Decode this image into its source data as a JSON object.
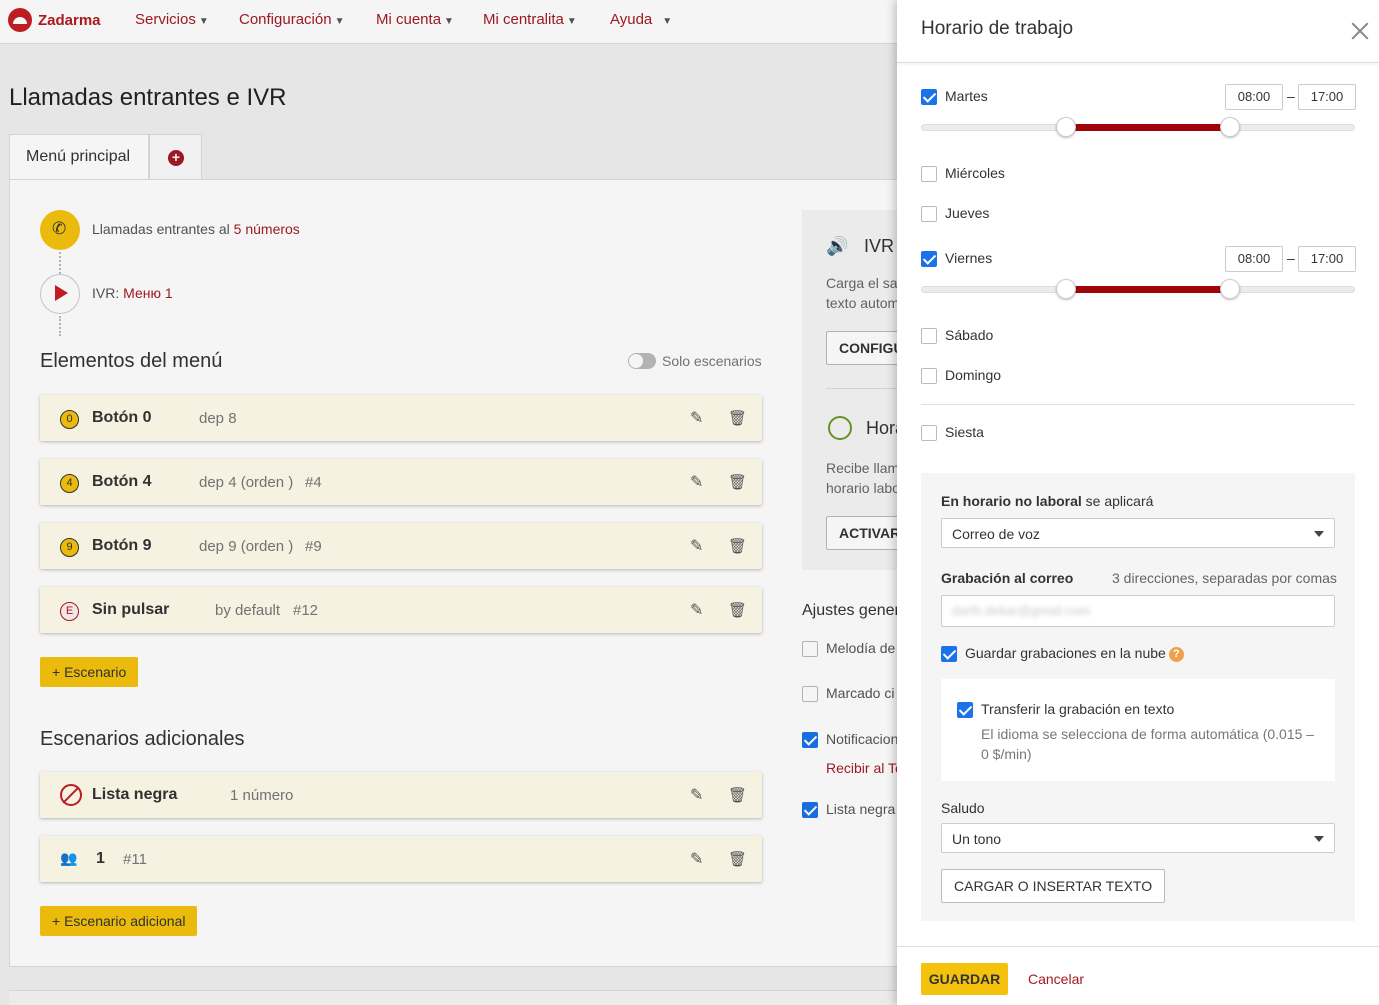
{
  "nav": {
    "logo": "Zadarma",
    "items": [
      {
        "label": "Servicios"
      },
      {
        "label": "Configuración"
      },
      {
        "label": "Mi cuenta"
      },
      {
        "label": "Mi centralita"
      },
      {
        "label": "Ayuda"
      }
    ]
  },
  "page": {
    "title": "Llamadas entrantes e IVR",
    "tabs": [
      {
        "label": "Menú principal"
      },
      {
        "label": "+"
      }
    ]
  },
  "flow": {
    "incoming_prefix": "Llamadas entrantes al",
    "incoming_link": "5 números",
    "ivr_prefix": "IVR:",
    "ivr_link": "Меню 1"
  },
  "menu": {
    "heading": "Elementos del menú",
    "toggle_label": "Solo escenarios",
    "rows": [
      {
        "badge": "0",
        "title": "Botón 0",
        "sub": "dep 8",
        "num": ""
      },
      {
        "badge": "4",
        "title": "Botón 4",
        "sub": "dep 4 (orden )",
        "num": "#4"
      },
      {
        "badge": "9",
        "title": "Botón 9",
        "sub": "dep 9 (orden )",
        "num": "#9"
      },
      {
        "badge": "E",
        "title": "Sin pulsar",
        "sub": "by default",
        "num": "#12"
      }
    ],
    "add_scenario": "+ Escenario"
  },
  "additional": {
    "heading": "Escenarios adicionales",
    "rows": [
      {
        "title": "Lista negra",
        "sub": "1 número",
        "icon": "ban-icon"
      },
      {
        "title": "1",
        "sub": "#11",
        "icon": "people-icon"
      }
    ],
    "add_button": "+ Escenario adicional"
  },
  "right_column": {
    "ivr_title": "IVR",
    "ivr_text_1": "Carga el sal",
    "ivr_text_2": "texto autom",
    "configure_btn": "CONFIGU",
    "hora_title": "Hora",
    "hora_text_1": "Recibe llam",
    "hora_text_2": "horario labo",
    "activar_btn": "ACTIVAR",
    "ajustes_heading": "Ajustes gener",
    "melodia": "Melodía de",
    "marcado": "Marcado ci",
    "notificacion": "Notificacion",
    "recibir": "Recibir al Te",
    "lista_negra": "Lista negra"
  },
  "panel": {
    "title": "Horario de trabajo",
    "days": [
      {
        "name": "Martes",
        "checked": true,
        "from": "08:00",
        "to": "17:00"
      },
      {
        "name": "Miércoles",
        "checked": false
      },
      {
        "name": "Jueves",
        "checked": false
      },
      {
        "name": "Viernes",
        "checked": true,
        "from": "08:00",
        "to": "17:00"
      },
      {
        "name": "Sábado",
        "checked": false
      },
      {
        "name": "Domingo",
        "checked": false
      }
    ],
    "siesta": "Siesta",
    "nonwork_bold": "En horario no laboral",
    "nonwork_rest": " se aplicará",
    "nonwork_select": "Correo de voz",
    "recording_label": "Grabación al correo",
    "recording_hint": "3 direcciones, separadas por comas",
    "recording_value": "darth.dekar@gmail.com",
    "cloud_label": "Guardar grabaciones en la nube",
    "transcribe_label": "Transferir la grabación en texto",
    "transcribe_hint_1": "El idioma se selecciona de forma automática (0.015 –",
    "transcribe_hint_2": "0 $/min)",
    "greeting_label": "Saludo",
    "greeting_select": "Un tono",
    "upload_btn": "CARGAR O INSERTAR TEXTO",
    "save_btn": "GUARDAR",
    "cancel_btn": "Cancelar"
  },
  "colors": {
    "brand": "#a31b23",
    "accent_yellow": "#f4c20d",
    "checkbox_blue": "#1a73e8",
    "slider_fill": "#a0050a"
  }
}
